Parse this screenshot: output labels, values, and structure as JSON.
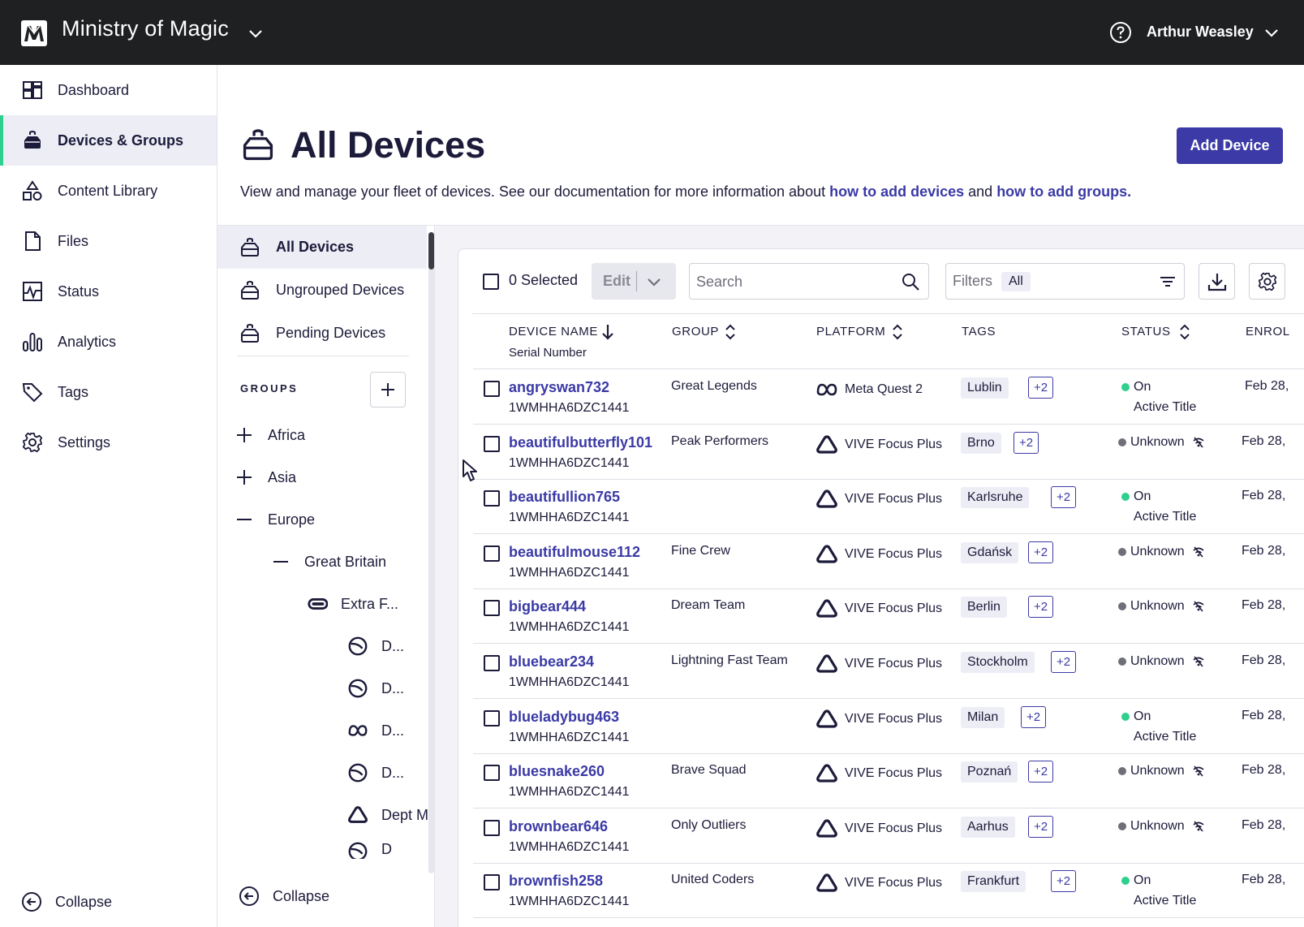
{
  "topbar": {
    "org_name": "Ministry of Magic",
    "user_name": "Arthur Weasley"
  },
  "nav": {
    "items": [
      {
        "label": "Dashboard",
        "icon": "dashboard-icon",
        "active": false
      },
      {
        "label": "Devices & Groups",
        "icon": "headset-icon",
        "active": true
      },
      {
        "label": "Content Library",
        "icon": "shapes-icon",
        "active": false
      },
      {
        "label": "Files",
        "icon": "file-icon",
        "active": false
      },
      {
        "label": "Status",
        "icon": "pulse-icon",
        "active": false
      },
      {
        "label": "Analytics",
        "icon": "bar-chart-icon",
        "active": false
      },
      {
        "label": "Tags",
        "icon": "tag-icon",
        "active": false
      },
      {
        "label": "Settings",
        "icon": "gear-icon",
        "active": false
      }
    ],
    "collapse_label": "Collapse"
  },
  "header": {
    "title": "All Devices",
    "add_device_label": "Add Device",
    "description_prefix": "View and manage your fleet of devices. See our documentation for more information about ",
    "link_devices": "how to add devices",
    "description_and": " and ",
    "link_groups": "how to add groups",
    "description_suffix": "."
  },
  "groups_panel": {
    "items": [
      {
        "label": "All Devices",
        "active": true
      },
      {
        "label": "Ungrouped Devices",
        "active": false
      },
      {
        "label": "Pending Devices",
        "active": false
      }
    ],
    "groups_heading": "GROUPS",
    "tree": [
      {
        "label": "Africa",
        "toggle": "expand"
      },
      {
        "label": "Asia",
        "toggle": "expand"
      },
      {
        "label": "Europe",
        "toggle": "collapse"
      },
      {
        "label": "Great Britain",
        "toggle": "collapse"
      },
      {
        "label": "Extra F...",
        "icon": "pico-headset-icon"
      },
      {
        "label": "D...",
        "icon": "pico-logo-icon"
      },
      {
        "label": "D...",
        "icon": "pico-logo-icon"
      },
      {
        "label": "D...",
        "icon": "meta-logo-icon"
      },
      {
        "label": "D...",
        "icon": "pico-logo-icon"
      },
      {
        "label": "Dept M",
        "icon": "vive-logo-icon"
      },
      {
        "label": "D",
        "icon": "pico-logo-icon"
      }
    ],
    "collapse_label": "Collapse"
  },
  "toolbar": {
    "selected_label": "0 Selected",
    "edit_label": "Edit",
    "search_placeholder": "Search",
    "filters_label": "Filters",
    "filters_value": "All"
  },
  "table": {
    "columns": {
      "device_name": "DEVICE NAME",
      "device_sub": "Serial Number",
      "group": "GROUP",
      "platform": "PLATFORM",
      "tags": "TAGS",
      "status": "STATUS",
      "enrolled": "ENROL"
    },
    "rows": [
      {
        "name": "angryswan732",
        "serial": "1WMHHA6DZC1441",
        "group": "Great Legends",
        "platform": "Meta Quest 2",
        "platform_icon": "meta-logo-icon",
        "tag": "Lublin",
        "more": "+2",
        "status": "On",
        "status_sub": "Active Title",
        "enrolled": "Feb 28,"
      },
      {
        "name": "beautifulbutterfly101",
        "serial": "1WMHHA6DZC1441",
        "group": "Peak Performers",
        "platform": "VIVE Focus Plus",
        "platform_icon": "vive-logo-icon",
        "tag": "Brno",
        "more": "+2",
        "status": "Unknown",
        "status_sub": "",
        "enrolled": "Feb 28,"
      },
      {
        "name": "beautifullion765",
        "serial": "1WMHHA6DZC1441",
        "group": "",
        "platform": "VIVE Focus Plus",
        "platform_icon": "vive-logo-icon",
        "tag": "Karlsruhe",
        "more": "+2",
        "status": "On",
        "status_sub": "Active Title",
        "enrolled": "Feb 28,"
      },
      {
        "name": "beautifulmouse112",
        "serial": "1WMHHA6DZC1441",
        "group": "Fine Crew",
        "platform": "VIVE Focus Plus",
        "platform_icon": "vive-logo-icon",
        "tag": "Gdańsk",
        "more": "+2",
        "status": "Unknown",
        "status_sub": "",
        "enrolled": "Feb 28,"
      },
      {
        "name": "bigbear444",
        "serial": "1WMHHA6DZC1441",
        "group": "Dream Team",
        "platform": "VIVE Focus Plus",
        "platform_icon": "vive-logo-icon",
        "tag": "Berlin",
        "more": "+2",
        "status": "Unknown",
        "status_sub": "",
        "enrolled": "Feb 28,"
      },
      {
        "name": "bluebear234",
        "serial": "1WMHHA6DZC1441",
        "group": "Lightning Fast Team",
        "platform": "VIVE Focus Plus",
        "platform_icon": "vive-logo-icon",
        "tag": "Stockholm",
        "more": "+2",
        "status": "Unknown",
        "status_sub": "",
        "enrolled": "Feb 28,"
      },
      {
        "name": "blueladybug463",
        "serial": "1WMHHA6DZC1441",
        "group": "",
        "platform": "VIVE Focus Plus",
        "platform_icon": "vive-logo-icon",
        "tag": "Milan",
        "more": "+2",
        "status": "On",
        "status_sub": "Active Title",
        "enrolled": "Feb 28,"
      },
      {
        "name": "bluesnake260",
        "serial": "1WMHHA6DZC1441",
        "group": "Brave Squad",
        "platform": "VIVE Focus Plus",
        "platform_icon": "vive-logo-icon",
        "tag": "Poznań",
        "more": "+2",
        "status": "Unknown",
        "status_sub": "",
        "enrolled": "Feb 28,"
      },
      {
        "name": "brownbear646",
        "serial": "1WMHHA6DZC1441",
        "group": "Only Outliers",
        "platform": "VIVE Focus Plus",
        "platform_icon": "vive-logo-icon",
        "tag": "Aarhus",
        "more": "+2",
        "status": "Unknown",
        "status_sub": "",
        "enrolled": "Feb 28,"
      },
      {
        "name": "brownfish258",
        "serial": "1WMHHA6DZC1441",
        "group": "United Coders",
        "platform": "VIVE Focus Plus",
        "platform_icon": "vive-logo-icon",
        "tag": "Frankfurt",
        "more": "+2",
        "status": "On",
        "status_sub": "Active Title",
        "enrolled": "Feb 28,"
      }
    ]
  },
  "colors": {
    "topbar_bg": "#1e2022",
    "accent": "#3b3aa6",
    "active_bg": "#ededf6",
    "active_bar": "#2fcf8e",
    "status_on": "#2fcf8e",
    "status_unknown": "#6f6f7a"
  }
}
